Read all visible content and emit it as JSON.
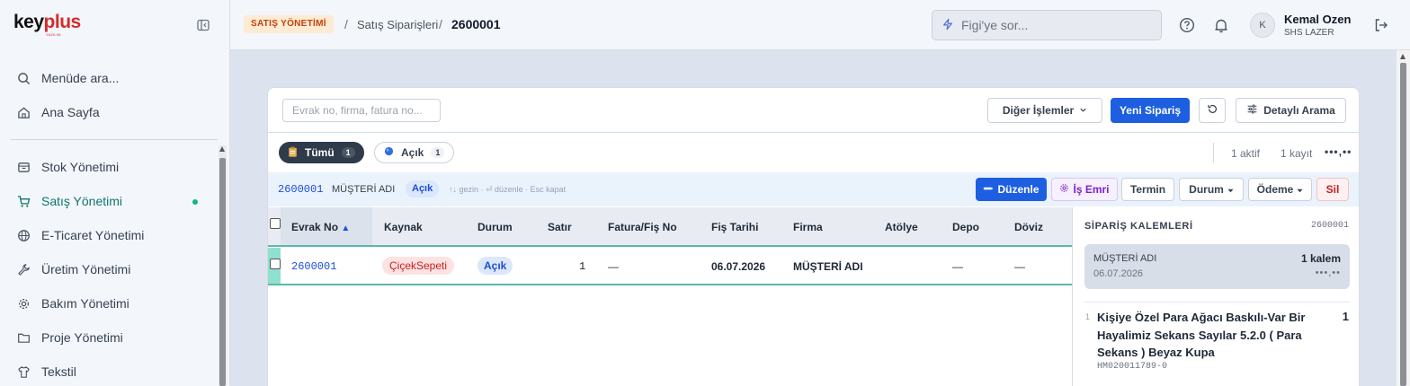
{
  "brand": {
    "logo_main": "key",
    "logo_accent": "plus",
    "logo_sub": "YAZILIM"
  },
  "sidebar": {
    "search_label": "Menüde ara...",
    "home_label": "Ana Sayfa",
    "items": [
      {
        "label": "Stok Yönetimi",
        "icon": "box-icon"
      },
      {
        "label": "Satış Yönetimi",
        "icon": "cart-icon",
        "active": true
      },
      {
        "label": "E-Ticaret Yönetimi",
        "icon": "globe-icon"
      },
      {
        "label": "Üretim Yönetimi",
        "icon": "wrench-icon"
      },
      {
        "label": "Bakım Yönetimi",
        "icon": "gear-icon"
      },
      {
        "label": "Proje Yönetimi",
        "icon": "folder-icon"
      },
      {
        "label": "Tekstil",
        "icon": "shirt-icon"
      }
    ]
  },
  "topbar": {
    "module_badge": "SATIŞ YÖNETİMİ",
    "separator": "/",
    "crumb_link": "Satış Siparişleri",
    "crumb_current": "2600001",
    "ask_placeholder": "Figi'ye sor...",
    "user_initial": "K",
    "user_name": "Kemal Ozen",
    "user_company": "SHS LAZER"
  },
  "toolbar": {
    "search_placeholder": "Evrak no, firma, fatura no...",
    "other_actions": "Diğer İşlemler",
    "new_order": "Yeni Sipariş",
    "detailed_search": "Detaylı Arama"
  },
  "filters": {
    "all_label": "Tümü",
    "all_count": "1",
    "open_label": "Açık",
    "open_count": "1",
    "active_stat": "1 aktif",
    "record_stat": "1 kayıt",
    "more": "•••,••"
  },
  "selection": {
    "doc_no": "2600001",
    "firm": "MÜŞTERİ ADI",
    "status": "Açık",
    "hint": "↑↓ gezin · ⏎ düzenle · Esc kapat",
    "actions": {
      "edit": "Düzenle",
      "work_order": "İş Emri",
      "term": "Termin",
      "status": "Durum",
      "payment": "Ödeme",
      "delete": "Sil"
    }
  },
  "table": {
    "columns": [
      "Evrak No",
      "Kaynak",
      "Durum",
      "Satır",
      "Fatura/Fiş No",
      "Fiş Tarihi",
      "Firma",
      "Atölye",
      "Depo",
      "Döviz"
    ],
    "sort_arrow": "▲",
    "rows": [
      {
        "doc_no": "2600001",
        "source": "ÇiçekSepeti",
        "status": "Açık",
        "lines": "1",
        "invoice_no": "—",
        "date": "06.07.2026",
        "firm": "MÜŞTERİ ADI",
        "workshop": "",
        "depot": "—",
        "currency": "—"
      }
    ]
  },
  "order_panel": {
    "title": "SİPARİŞ KALEMLERİ",
    "code": "2600001",
    "firm": "MÜŞTERİ ADI",
    "count": "1 kalem",
    "date": "06.07.2026",
    "dots": "•••,••",
    "item_index": "1",
    "item_name": "Kişiye Özel Para Ağacı Baskılı-Var Bir Hayalimiz Sekans Sayılar 5.2.0 ( Para Sekans ) Beyaz Kupa",
    "item_qty": "1",
    "item_sku": "HM020011789-0"
  },
  "colors": {
    "primary": "#1d5fe0",
    "accent_teal": "#0f766e",
    "danger": "#c81e1e",
    "badge_orange": "#c2410c"
  }
}
